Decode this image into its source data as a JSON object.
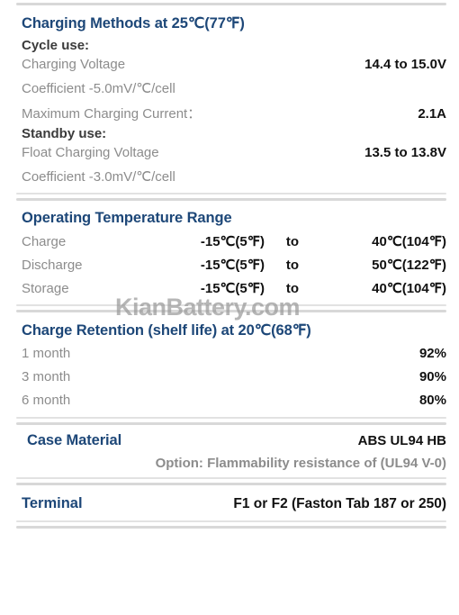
{
  "watermark": "KianBattery.com",
  "colors": {
    "heading": "#1d4778",
    "label": "#8c8c8c",
    "value": "#111111",
    "divider": "#d8d8d8",
    "background": "#ffffff"
  },
  "sections": {
    "charging": {
      "title": "Charging Methods at 25℃(77℉)",
      "cycle_use_label": "Cycle use:",
      "charging_voltage_label": "Charging Voltage",
      "charging_voltage_value": "14.4 to 15.0V",
      "cycle_coefficient_label": "Coefficient -5.0mV/℃/cell",
      "max_current_label": "Maximum Charging Current：",
      "max_current_value": "2.1A",
      "standby_use_label": "Standby use:",
      "float_voltage_label": "Float Charging Voltage",
      "float_voltage_value": "13.5 to 13.8V",
      "standby_coefficient_label": "Coefficient -3.0mV/℃/cell"
    },
    "temperature": {
      "title": "Operating Temperature Range",
      "to_label": "to",
      "rows": [
        {
          "label": "Charge",
          "min": "-15℃(5℉)",
          "to": "to",
          "max": "40℃(104℉)"
        },
        {
          "label": "Discharge",
          "min": "-15℃(5℉)",
          "to": "to",
          "max": "50℃(122℉)"
        },
        {
          "label": "Storage",
          "min": "-15℃(5℉)",
          "to": "to",
          "max": "40℃(104℉)"
        }
      ]
    },
    "retention": {
      "title": "Charge Retention (shelf life) at 20℃(68℉)",
      "rows": [
        {
          "label": "1 month",
          "value": "92%"
        },
        {
          "label": "3 month",
          "value": "90%"
        },
        {
          "label": "6 month",
          "value": "80%"
        }
      ]
    },
    "case_material": {
      "title": "Case Material",
      "value": "ABS UL94 HB",
      "option_note": "Option: Flammability resistance of (UL94 V-0)"
    },
    "terminal": {
      "title": "Terminal",
      "value": "F1 or F2 (Faston Tab 187 or 250)"
    }
  }
}
